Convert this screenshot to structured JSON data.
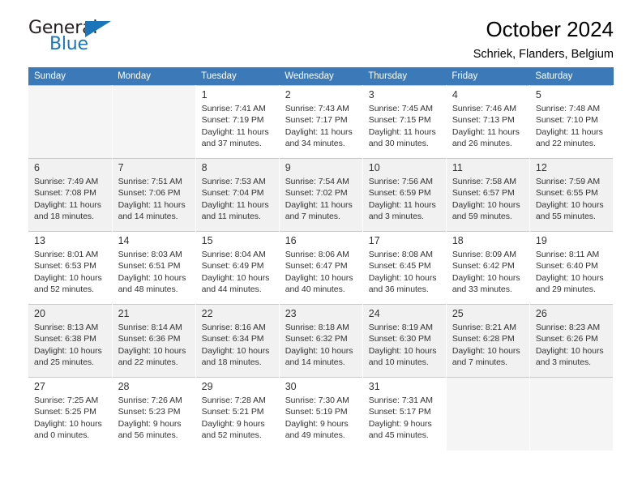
{
  "brand": {
    "name_part1": "General",
    "name_part2": "Blue",
    "accent_color": "#1b75bb"
  },
  "header": {
    "title": "October 2024",
    "subtitle": "Schriek, Flanders, Belgium"
  },
  "calendar": {
    "header_color": "#3b79b8",
    "weekdays": [
      "Sunday",
      "Monday",
      "Tuesday",
      "Wednesday",
      "Thursday",
      "Friday",
      "Saturday"
    ],
    "labels": {
      "sunrise": "Sunrise:",
      "sunset": "Sunset:",
      "daylight": "Daylight:"
    },
    "weeks": [
      {
        "shaded": false,
        "days": [
          null,
          null,
          {
            "day": "1",
            "sunrise": "Sunrise: 7:41 AM",
            "sunset": "Sunset: 7:19 PM",
            "daylight_1": "Daylight: 11 hours",
            "daylight_2": "and 37 minutes."
          },
          {
            "day": "2",
            "sunrise": "Sunrise: 7:43 AM",
            "sunset": "Sunset: 7:17 PM",
            "daylight_1": "Daylight: 11 hours",
            "daylight_2": "and 34 minutes."
          },
          {
            "day": "3",
            "sunrise": "Sunrise: 7:45 AM",
            "sunset": "Sunset: 7:15 PM",
            "daylight_1": "Daylight: 11 hours",
            "daylight_2": "and 30 minutes."
          },
          {
            "day": "4",
            "sunrise": "Sunrise: 7:46 AM",
            "sunset": "Sunset: 7:13 PM",
            "daylight_1": "Daylight: 11 hours",
            "daylight_2": "and 26 minutes."
          },
          {
            "day": "5",
            "sunrise": "Sunrise: 7:48 AM",
            "sunset": "Sunset: 7:10 PM",
            "daylight_1": "Daylight: 11 hours",
            "daylight_2": "and 22 minutes."
          }
        ]
      },
      {
        "shaded": true,
        "days": [
          {
            "day": "6",
            "sunrise": "Sunrise: 7:49 AM",
            "sunset": "Sunset: 7:08 PM",
            "daylight_1": "Daylight: 11 hours",
            "daylight_2": "and 18 minutes."
          },
          {
            "day": "7",
            "sunrise": "Sunrise: 7:51 AM",
            "sunset": "Sunset: 7:06 PM",
            "daylight_1": "Daylight: 11 hours",
            "daylight_2": "and 14 minutes."
          },
          {
            "day": "8",
            "sunrise": "Sunrise: 7:53 AM",
            "sunset": "Sunset: 7:04 PM",
            "daylight_1": "Daylight: 11 hours",
            "daylight_2": "and 11 minutes."
          },
          {
            "day": "9",
            "sunrise": "Sunrise: 7:54 AM",
            "sunset": "Sunset: 7:02 PM",
            "daylight_1": "Daylight: 11 hours",
            "daylight_2": "and 7 minutes."
          },
          {
            "day": "10",
            "sunrise": "Sunrise: 7:56 AM",
            "sunset": "Sunset: 6:59 PM",
            "daylight_1": "Daylight: 11 hours",
            "daylight_2": "and 3 minutes."
          },
          {
            "day": "11",
            "sunrise": "Sunrise: 7:58 AM",
            "sunset": "Sunset: 6:57 PM",
            "daylight_1": "Daylight: 10 hours",
            "daylight_2": "and 59 minutes."
          },
          {
            "day": "12",
            "sunrise": "Sunrise: 7:59 AM",
            "sunset": "Sunset: 6:55 PM",
            "daylight_1": "Daylight: 10 hours",
            "daylight_2": "and 55 minutes."
          }
        ]
      },
      {
        "shaded": false,
        "days": [
          {
            "day": "13",
            "sunrise": "Sunrise: 8:01 AM",
            "sunset": "Sunset: 6:53 PM",
            "daylight_1": "Daylight: 10 hours",
            "daylight_2": "and 52 minutes."
          },
          {
            "day": "14",
            "sunrise": "Sunrise: 8:03 AM",
            "sunset": "Sunset: 6:51 PM",
            "daylight_1": "Daylight: 10 hours",
            "daylight_2": "and 48 minutes."
          },
          {
            "day": "15",
            "sunrise": "Sunrise: 8:04 AM",
            "sunset": "Sunset: 6:49 PM",
            "daylight_1": "Daylight: 10 hours",
            "daylight_2": "and 44 minutes."
          },
          {
            "day": "16",
            "sunrise": "Sunrise: 8:06 AM",
            "sunset": "Sunset: 6:47 PM",
            "daylight_1": "Daylight: 10 hours",
            "daylight_2": "and 40 minutes."
          },
          {
            "day": "17",
            "sunrise": "Sunrise: 8:08 AM",
            "sunset": "Sunset: 6:45 PM",
            "daylight_1": "Daylight: 10 hours",
            "daylight_2": "and 36 minutes."
          },
          {
            "day": "18",
            "sunrise": "Sunrise: 8:09 AM",
            "sunset": "Sunset: 6:42 PM",
            "daylight_1": "Daylight: 10 hours",
            "daylight_2": "and 33 minutes."
          },
          {
            "day": "19",
            "sunrise": "Sunrise: 8:11 AM",
            "sunset": "Sunset: 6:40 PM",
            "daylight_1": "Daylight: 10 hours",
            "daylight_2": "and 29 minutes."
          }
        ]
      },
      {
        "shaded": true,
        "days": [
          {
            "day": "20",
            "sunrise": "Sunrise: 8:13 AM",
            "sunset": "Sunset: 6:38 PM",
            "daylight_1": "Daylight: 10 hours",
            "daylight_2": "and 25 minutes."
          },
          {
            "day": "21",
            "sunrise": "Sunrise: 8:14 AM",
            "sunset": "Sunset: 6:36 PM",
            "daylight_1": "Daylight: 10 hours",
            "daylight_2": "and 22 minutes."
          },
          {
            "day": "22",
            "sunrise": "Sunrise: 8:16 AM",
            "sunset": "Sunset: 6:34 PM",
            "daylight_1": "Daylight: 10 hours",
            "daylight_2": "and 18 minutes."
          },
          {
            "day": "23",
            "sunrise": "Sunrise: 8:18 AM",
            "sunset": "Sunset: 6:32 PM",
            "daylight_1": "Daylight: 10 hours",
            "daylight_2": "and 14 minutes."
          },
          {
            "day": "24",
            "sunrise": "Sunrise: 8:19 AM",
            "sunset": "Sunset: 6:30 PM",
            "daylight_1": "Daylight: 10 hours",
            "daylight_2": "and 10 minutes."
          },
          {
            "day": "25",
            "sunrise": "Sunrise: 8:21 AM",
            "sunset": "Sunset: 6:28 PM",
            "daylight_1": "Daylight: 10 hours",
            "daylight_2": "and 7 minutes."
          },
          {
            "day": "26",
            "sunrise": "Sunrise: 8:23 AM",
            "sunset": "Sunset: 6:26 PM",
            "daylight_1": "Daylight: 10 hours",
            "daylight_2": "and 3 minutes."
          }
        ]
      },
      {
        "shaded": false,
        "days": [
          {
            "day": "27",
            "sunrise": "Sunrise: 7:25 AM",
            "sunset": "Sunset: 5:25 PM",
            "daylight_1": "Daylight: 10 hours",
            "daylight_2": "and 0 minutes."
          },
          {
            "day": "28",
            "sunrise": "Sunrise: 7:26 AM",
            "sunset": "Sunset: 5:23 PM",
            "daylight_1": "Daylight: 9 hours",
            "daylight_2": "and 56 minutes."
          },
          {
            "day": "29",
            "sunrise": "Sunrise: 7:28 AM",
            "sunset": "Sunset: 5:21 PM",
            "daylight_1": "Daylight: 9 hours",
            "daylight_2": "and 52 minutes."
          },
          {
            "day": "30",
            "sunrise": "Sunrise: 7:30 AM",
            "sunset": "Sunset: 5:19 PM",
            "daylight_1": "Daylight: 9 hours",
            "daylight_2": "and 49 minutes."
          },
          {
            "day": "31",
            "sunrise": "Sunrise: 7:31 AM",
            "sunset": "Sunset: 5:17 PM",
            "daylight_1": "Daylight: 9 hours",
            "daylight_2": "and 45 minutes."
          },
          null,
          null
        ]
      }
    ]
  }
}
